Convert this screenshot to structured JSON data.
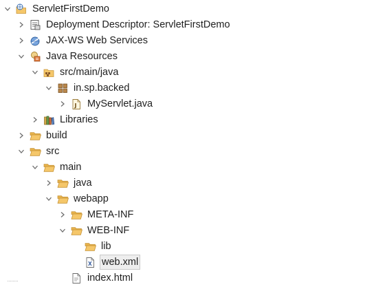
{
  "tree": {
    "project": "ServletFirstDemo",
    "deployment_descriptor": "Deployment Descriptor: ServletFirstDemo",
    "jaxws": "JAX-WS Web Services",
    "java_resources": "Java Resources",
    "src_main_java": "src/main/java",
    "package": "in.sp.backed",
    "servlet_file": "MyServlet.java",
    "libraries": "Libraries",
    "build": "build",
    "src": "src",
    "main": "main",
    "java": "java",
    "webapp": "webapp",
    "meta_inf": "META-INF",
    "web_inf": "WEB-INF",
    "lib": "lib",
    "web_xml": "web.xml",
    "index_html": "index.html"
  },
  "colors": {
    "folder": "#f5c76a",
    "folder_edge": "#c9963a",
    "twisty": "#6e6e6e",
    "selection": "#eeeeee"
  }
}
